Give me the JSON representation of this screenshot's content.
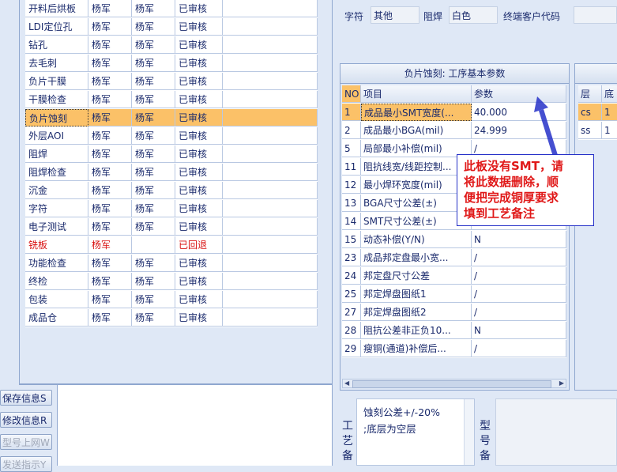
{
  "process_list": [
    {
      "name": "开料后烘板",
      "op1": "杨军",
      "op2": "杨军",
      "status": "已审核"
    },
    {
      "name": "LDI定位孔",
      "op1": "杨军",
      "op2": "杨军",
      "status": "已审核"
    },
    {
      "name": "钻孔",
      "op1": "杨军",
      "op2": "杨军",
      "status": "已审核"
    },
    {
      "name": "去毛刺",
      "op1": "杨军",
      "op2": "杨军",
      "status": "已审核"
    },
    {
      "name": "负片干膜",
      "op1": "杨军",
      "op2": "杨军",
      "status": "已审核"
    },
    {
      "name": "干膜检查",
      "op1": "杨军",
      "op2": "杨军",
      "status": "已审核"
    },
    {
      "name": "负片蚀刻",
      "op1": "杨军",
      "op2": "杨军",
      "status": "已审核"
    },
    {
      "name": "外层AOI",
      "op1": "杨军",
      "op2": "杨军",
      "status": "已审核"
    },
    {
      "name": "阻焊",
      "op1": "杨军",
      "op2": "杨军",
      "status": "已审核"
    },
    {
      "name": "阻焊检查",
      "op1": "杨军",
      "op2": "杨军",
      "status": "已审核"
    },
    {
      "name": "沉金",
      "op1": "杨军",
      "op2": "杨军",
      "status": "已审核"
    },
    {
      "name": "字符",
      "op1": "杨军",
      "op2": "杨军",
      "status": "已审核"
    },
    {
      "name": "电子测试",
      "op1": "杨军",
      "op2": "杨军",
      "status": "已审核"
    },
    {
      "name": "铣板",
      "op1": "杨军",
      "op2": "",
      "status": "已回退"
    },
    {
      "name": "功能检查",
      "op1": "杨军",
      "op2": "杨军",
      "status": "已审核"
    },
    {
      "name": "终检",
      "op1": "杨军",
      "op2": "杨军",
      "status": "已审核"
    },
    {
      "name": "包装",
      "op1": "杨军",
      "op2": "杨军",
      "status": "已审核"
    },
    {
      "name": "成品仓",
      "op1": "杨军",
      "op2": "杨军",
      "status": "已审核"
    }
  ],
  "buttons": {
    "save": "保存信息S",
    "modify": "修改信息R",
    "upload": "型号上网W",
    "send": "发送指示Y"
  },
  "top_form": {
    "char_label": "字符",
    "char_value": "其他",
    "mask_label": "阻焊",
    "mask_value": "白色",
    "customer_code_label": "终端客户代码",
    "customer_code_value": ""
  },
  "param_panel": {
    "title": "负片蚀刻: 工序基本参数",
    "headers": {
      "no": "NO",
      "item": "项目",
      "param": "参数"
    },
    "rows": [
      {
        "no": "1",
        "item": "成品最小SMT宽度(...",
        "param": "40.000"
      },
      {
        "no": "2",
        "item": "成品最小BGA(mil)",
        "param": "24.999"
      },
      {
        "no": "5",
        "item": "局部最小补偿(mil)",
        "param": "/"
      },
      {
        "no": "11",
        "item": "阻抗线宽/线距控制...",
        "param": ""
      },
      {
        "no": "12",
        "item": "最小焊环宽度(mil)",
        "param": ""
      },
      {
        "no": "13",
        "item": "BGA尺寸公差(±)",
        "param": ""
      },
      {
        "no": "14",
        "item": "SMT尺寸公差(±)",
        "param": ""
      },
      {
        "no": "15",
        "item": "动态补偿(Y/N)",
        "param": "N"
      },
      {
        "no": "23",
        "item": "成品邦定盘最小宽...",
        "param": "/"
      },
      {
        "no": "24",
        "item": "邦定盘尺寸公差",
        "param": "/"
      },
      {
        "no": "25",
        "item": "邦定焊盘图纸1",
        "param": "/"
      },
      {
        "no": "27",
        "item": "邦定焊盘图纸2",
        "param": "/"
      },
      {
        "no": "28",
        "item": "阻抗公差非正负10...",
        "param": "N"
      },
      {
        "no": "29",
        "item": "瘦铜(通道)补偿后...",
        "param": "/"
      }
    ]
  },
  "layer_panel": {
    "headers": {
      "layer": "层",
      "bottom": "底"
    },
    "rows": [
      {
        "layer": "cs",
        "bottom": "1"
      },
      {
        "layer": "ss",
        "bottom": "1"
      }
    ]
  },
  "memo": {
    "label": "工艺备",
    "text_line1": "蚀刻公差+/-20%",
    "text_line2": ";底层为空层",
    "model_label": "型号备"
  },
  "annotation": {
    "line1": "此板没有SMT，请",
    "line2": "将此数据删除，顺",
    "line3": "便把完成铜厚要求",
    "line4": "填到工艺备注"
  },
  "colors": {
    "selection": "#fbc168",
    "rollback_text": "#d81010",
    "callout_text": "#e01818",
    "arrow": "#2530c8"
  }
}
